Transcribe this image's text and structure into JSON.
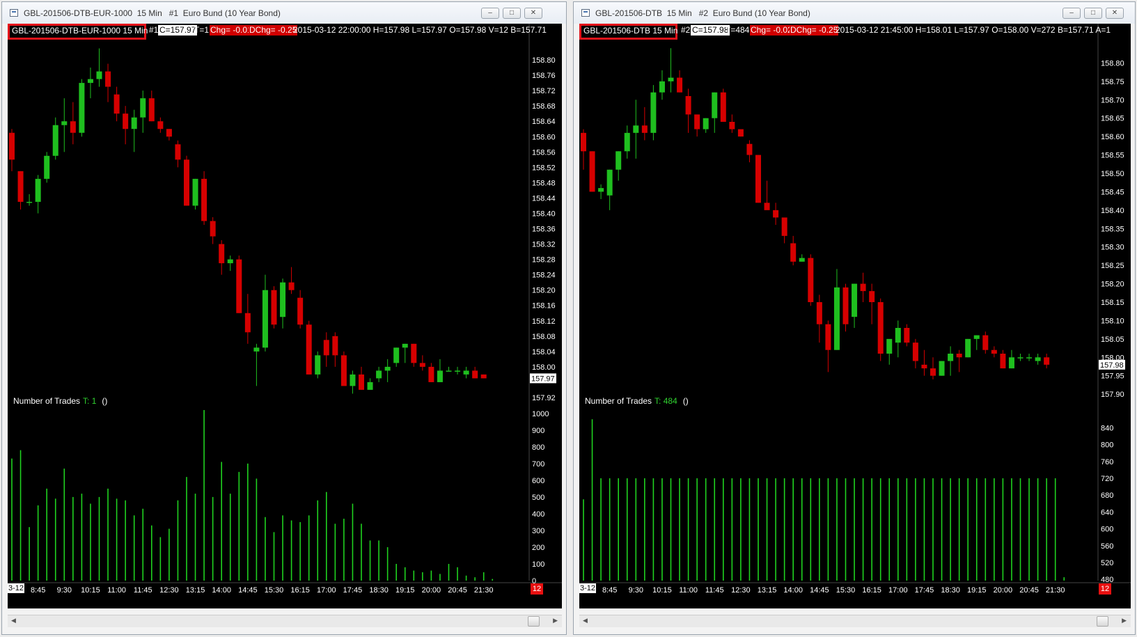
{
  "colors": {
    "up": "#1fbf1f",
    "down": "#d60000",
    "volume": "#1fd21f",
    "background": "#000000",
    "highlight": "#e4141b"
  },
  "windows": [
    {
      "id": "A",
      "title": "GBL-201506-DTB-EUR-1000  15 Min   #1  Euro Bund (10 Year Bond)",
      "symbol_label": "GBL-201506-DTB-EUR-1000  15 Min",
      "header": {
        "num": "#1",
        "close": "C=157.97",
        "trades": "T=1",
        "chg": "Chg= -0.01",
        "dchg": "DChg= -0.25",
        "rest": "2015-03-12 22:00:00 H=157.98 L=157.97 O=157.98 V=12 B=157.71"
      },
      "price_ticks": [
        "158.80",
        "158.76",
        "158.72",
        "158.68",
        "158.64",
        "158.60",
        "158.56",
        "158.52",
        "158.48",
        "158.44",
        "158.40",
        "158.36",
        "158.32",
        "158.28",
        "158.24",
        "158.20",
        "158.16",
        "158.12",
        "158.08",
        "158.04",
        "158.00",
        "157.92"
      ],
      "last_price": "157.97",
      "indicator": {
        "name": "Number of Trades",
        "value": "T: 1",
        "paren": "()"
      },
      "volume_ticks": [
        "1000",
        "900",
        "800",
        "700",
        "600",
        "500",
        "400",
        "300",
        "200",
        "100",
        "0"
      ],
      "time_labels": [
        "8:45",
        "9:30",
        "10:15",
        "11:00",
        "11:45",
        "12:30",
        "13:15",
        "14:00",
        "14:45",
        "15:30",
        "16:15",
        "17:00",
        "17:45",
        "18:30",
        "19:15",
        "20:00",
        "20:45",
        "21:30"
      ],
      "left_date": "3-12",
      "corner": "12"
    },
    {
      "id": "B",
      "title": "GBL-201506-DTB  15 Min   #2  Euro Bund (10 Year Bond)",
      "symbol_label": "GBL-201506-DTB  15 Min",
      "header": {
        "num": "#2",
        "close": "C=157.98",
        "trades": "T=484",
        "chg": "Chg= -0.02",
        "dchg": "DChg= -0.25",
        "rest": "2015-03-12 21:45:00 H=158.01 L=157.97 O=158.00 V=272 B=157.71  A=1"
      },
      "price_ticks": [
        "158.80",
        "158.75",
        "158.70",
        "158.65",
        "158.60",
        "158.55",
        "158.50",
        "158.45",
        "158.40",
        "158.35",
        "158.30",
        "158.25",
        "158.20",
        "158.15",
        "158.10",
        "158.05",
        "158.00",
        "157.95",
        "157.90"
      ],
      "last_price": "157.98",
      "indicator": {
        "name": "Number of Trades",
        "value": "T: 484",
        "paren": "()"
      },
      "volume_ticks": [
        "840",
        "800",
        "760",
        "720",
        "680",
        "640",
        "600",
        "560",
        "520",
        "480"
      ],
      "time_labels": [
        "8:45",
        "9:30",
        "10:15",
        "11:00",
        "11:45",
        "12:30",
        "13:15",
        "14:00",
        "14:45",
        "15:30",
        "16:15",
        "17:00",
        "17:45",
        "18:30",
        "19:15",
        "20:00",
        "20:45",
        "21:30"
      ],
      "left_date": "3-12",
      "corner": "12"
    }
  ],
  "chart_data": [
    {
      "type": "candlestick",
      "title": "GBL-201506-DTB-EUR-1000 15 Min",
      "ylim": [
        157.9,
        158.84
      ],
      "candles": [
        [
          158.61,
          158.62,
          158.51,
          158.54
        ],
        [
          158.51,
          158.51,
          158.41,
          158.43
        ],
        [
          158.43,
          158.45,
          158.42,
          158.43
        ],
        [
          158.43,
          158.5,
          158.4,
          158.49
        ],
        [
          158.49,
          158.56,
          158.48,
          158.55
        ],
        [
          158.55,
          158.65,
          158.54,
          158.63
        ],
        [
          158.63,
          158.7,
          158.56,
          158.64
        ],
        [
          158.64,
          158.69,
          158.58,
          158.61
        ],
        [
          158.61,
          158.75,
          158.6,
          158.74
        ],
        [
          158.74,
          158.78,
          158.7,
          158.75
        ],
        [
          158.75,
          158.83,
          158.73,
          158.77
        ],
        [
          158.77,
          158.79,
          158.69,
          158.73
        ],
        [
          158.71,
          158.73,
          158.64,
          158.66
        ],
        [
          158.66,
          158.68,
          158.58,
          158.62
        ],
        [
          158.62,
          158.67,
          158.56,
          158.65
        ],
        [
          158.65,
          158.72,
          158.61,
          158.7
        ],
        [
          158.7,
          158.72,
          158.64,
          158.64
        ],
        [
          158.64,
          158.65,
          158.61,
          158.62
        ],
        [
          158.62,
          158.62,
          158.59,
          158.6
        ],
        [
          158.58,
          158.59,
          158.52,
          158.54
        ],
        [
          158.54,
          158.55,
          158.42,
          158.42
        ],
        [
          158.42,
          158.49,
          158.41,
          158.49
        ],
        [
          158.49,
          158.51,
          158.37,
          158.38
        ],
        [
          158.38,
          158.39,
          158.32,
          158.34
        ],
        [
          158.32,
          158.33,
          158.24,
          158.27
        ],
        [
          158.27,
          158.29,
          158.25,
          158.28
        ],
        [
          158.28,
          158.29,
          158.14,
          158.14
        ],
        [
          158.14,
          158.19,
          158.06,
          158.09
        ],
        [
          158.04,
          158.06,
          157.95,
          158.05
        ],
        [
          158.05,
          158.24,
          158.04,
          158.2
        ],
        [
          158.2,
          158.21,
          158.1,
          158.11
        ],
        [
          158.13,
          158.23,
          158.1,
          158.22
        ],
        [
          158.22,
          158.26,
          158.19,
          158.2
        ],
        [
          158.18,
          158.2,
          158.1,
          158.11
        ],
        [
          158.11,
          158.12,
          157.98,
          157.98
        ],
        [
          157.98,
          158.04,
          157.97,
          158.03
        ],
        [
          158.07,
          158.09,
          158.0,
          158.03
        ],
        [
          158.08,
          158.09,
          158.0,
          158.03
        ],
        [
          158.03,
          158.04,
          157.96,
          157.95
        ],
        [
          157.95,
          157.99,
          157.93,
          157.98
        ],
        [
          157.98,
          158.0,
          157.94,
          157.94
        ],
        [
          157.94,
          157.97,
          157.94,
          157.96
        ],
        [
          157.97,
          158.0,
          157.96,
          157.99
        ],
        [
          157.99,
          158.02,
          157.96,
          158.0
        ],
        [
          158.01,
          158.05,
          158.0,
          158.05
        ],
        [
          158.05,
          158.06,
          158.01,
          158.06
        ],
        [
          158.06,
          158.06,
          158.0,
          158.01
        ],
        [
          158.01,
          158.03,
          157.99,
          158.0
        ],
        [
          158.0,
          158.01,
          157.96,
          157.96
        ],
        [
          157.96,
          158.02,
          157.96,
          157.99
        ],
        [
          157.99,
          158.0,
          157.99,
          157.99
        ],
        [
          157.99,
          158.0,
          157.98,
          157.99
        ],
        [
          157.98,
          158.0,
          157.97,
          157.99
        ],
        [
          157.99,
          158.0,
          157.97,
          157.97
        ],
        [
          157.98,
          157.98,
          157.97,
          157.97
        ]
      ],
      "volume": [
        730,
        780,
        320,
        450,
        550,
        490,
        670,
        500,
        520,
        460,
        500,
        550,
        490,
        480,
        390,
        430,
        330,
        260,
        310,
        480,
        620,
        520,
        1020,
        500,
        710,
        520,
        650,
        700,
        610,
        380,
        290,
        390,
        360,
        350,
        390,
        480,
        530,
        340,
        370,
        460,
        340,
        240,
        240,
        200,
        100,
        80,
        60,
        50,
        60,
        40,
        100,
        80,
        30,
        20,
        50,
        10
      ]
    },
    {
      "type": "candlestick",
      "title": "GBL-201506-DTB 15 Min",
      "ylim": [
        157.87,
        158.85
      ],
      "candles": [
        [
          158.61,
          158.62,
          158.51,
          158.56
        ],
        [
          158.56,
          158.56,
          158.45,
          158.45
        ],
        [
          158.45,
          158.47,
          158.43,
          158.46
        ],
        [
          158.44,
          158.51,
          158.4,
          158.51
        ],
        [
          158.51,
          158.56,
          158.48,
          158.56
        ],
        [
          158.56,
          158.63,
          158.54,
          158.61
        ],
        [
          158.61,
          158.7,
          158.54,
          158.63
        ],
        [
          158.63,
          158.68,
          158.59,
          158.61
        ],
        [
          158.61,
          158.74,
          158.59,
          158.72
        ],
        [
          158.72,
          158.78,
          158.7,
          158.75
        ],
        [
          158.75,
          158.84,
          158.72,
          158.76
        ],
        [
          158.76,
          158.78,
          158.72,
          158.72
        ],
        [
          158.71,
          158.73,
          158.61,
          158.66
        ],
        [
          158.66,
          158.66,
          158.6,
          158.62
        ],
        [
          158.62,
          158.65,
          158.61,
          158.65
        ],
        [
          158.65,
          158.72,
          158.61,
          158.72
        ],
        [
          158.72,
          158.73,
          158.64,
          158.64
        ],
        [
          158.64,
          158.66,
          158.61,
          158.62
        ],
        [
          158.62,
          158.61,
          158.6,
          158.6
        ],
        [
          158.58,
          158.59,
          158.53,
          158.55
        ],
        [
          158.55,
          158.55,
          158.42,
          158.42
        ],
        [
          158.42,
          158.48,
          158.41,
          158.4
        ],
        [
          158.4,
          158.42,
          158.36,
          158.38
        ],
        [
          158.38,
          158.37,
          158.31,
          158.33
        ],
        [
          158.31,
          158.33,
          158.25,
          158.26
        ],
        [
          158.26,
          158.28,
          158.26,
          158.27
        ],
        [
          158.27,
          158.28,
          158.14,
          158.15
        ],
        [
          158.15,
          158.17,
          158.04,
          158.09
        ],
        [
          158.09,
          158.1,
          157.96,
          158.02
        ],
        [
          158.02,
          158.24,
          158.02,
          158.19
        ],
        [
          158.19,
          158.2,
          158.07,
          158.09
        ],
        [
          158.11,
          158.2,
          158.08,
          158.2
        ],
        [
          158.2,
          158.23,
          158.15,
          158.18
        ],
        [
          158.18,
          158.2,
          158.09,
          158.15
        ],
        [
          158.15,
          158.16,
          157.99,
          158.01
        ],
        [
          158.01,
          158.02,
          157.98,
          158.05
        ],
        [
          158.04,
          158.1,
          158.0,
          158.08
        ],
        [
          158.08,
          158.09,
          158.03,
          158.04
        ],
        [
          158.04,
          158.05,
          157.97,
          157.99
        ],
        [
          157.98,
          158.02,
          157.95,
          157.97
        ],
        [
          157.97,
          158.0,
          157.94,
          157.95
        ],
        [
          157.95,
          157.99,
          157.95,
          157.99
        ],
        [
          157.99,
          158.03,
          157.95,
          158.01
        ],
        [
          158.01,
          158.02,
          157.96,
          158.0
        ],
        [
          158.0,
          158.05,
          158.0,
          158.05
        ],
        [
          158.05,
          158.06,
          158.02,
          158.06
        ],
        [
          158.06,
          158.07,
          158.01,
          158.02
        ],
        [
          158.02,
          158.03,
          158.0,
          158.01
        ],
        [
          158.01,
          158.02,
          157.97,
          157.97
        ],
        [
          157.97,
          158.02,
          157.97,
          158.0
        ],
        [
          158.0,
          158.01,
          157.99,
          158.0
        ],
        [
          158.0,
          158.01,
          157.99,
          158.0
        ],
        [
          157.99,
          158.01,
          157.98,
          158.0
        ],
        [
          158.0,
          158.01,
          157.97,
          157.98
        ]
      ],
      "volume": [
        670,
        860,
        720,
        720,
        720,
        720,
        720,
        720,
        720,
        720,
        720,
        720,
        720,
        720,
        720,
        720,
        720,
        720,
        720,
        720,
        720,
        720,
        720,
        720,
        720,
        720,
        720,
        720,
        720,
        720,
        720,
        720,
        720,
        720,
        720,
        720,
        720,
        720,
        720,
        720,
        720,
        720,
        720,
        720,
        720,
        720,
        720,
        720,
        720,
        720,
        720,
        720,
        720,
        720,
        720,
        485
      ]
    }
  ]
}
